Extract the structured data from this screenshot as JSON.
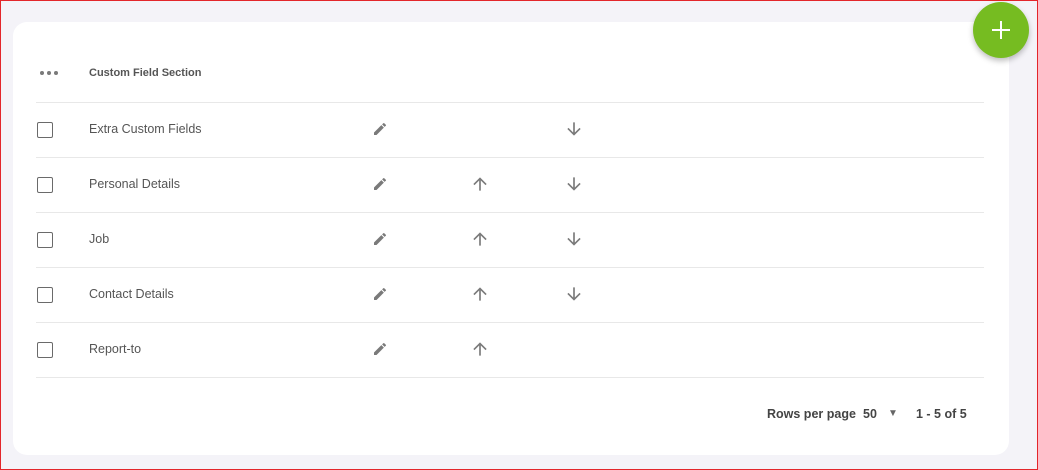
{
  "table": {
    "header": {
      "column_title": "Custom Field Section"
    },
    "rows": [
      {
        "label": "Extra Custom Fields",
        "actions": [
          "edit",
          "move-down"
        ]
      },
      {
        "label": "Personal Details",
        "actions": [
          "edit",
          "move-up",
          "move-down"
        ]
      },
      {
        "label": "Job",
        "actions": [
          "edit",
          "move-up",
          "move-down"
        ]
      },
      {
        "label": "Contact Details",
        "actions": [
          "edit",
          "move-up",
          "move-down"
        ]
      },
      {
        "label": "Report-to",
        "actions": [
          "edit",
          "move-up"
        ]
      }
    ]
  },
  "pagination": {
    "rows_per_page_label": "Rows per page",
    "rows_per_page_value": "50",
    "range_text": "1 - 5 of 5"
  },
  "icons": {
    "fab": "plus-icon",
    "more": "more-horizontal-icon",
    "edit": "pencil-icon",
    "up": "arrow-up-icon",
    "down": "arrow-down-icon"
  },
  "colors": {
    "accent": "#76bc21",
    "page_background": "#f4f3f8",
    "card_background": "#ffffff",
    "icon_gray": "#7a7a7a",
    "frame_border": "#e3262b"
  }
}
